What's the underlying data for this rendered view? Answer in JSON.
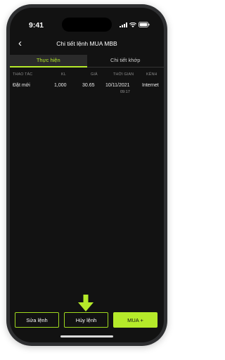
{
  "status_bar": {
    "time": "9:41"
  },
  "header": {
    "back_label": "‹",
    "title": "Chi tiết lệnh MUA MBB"
  },
  "tabs": [
    {
      "label": "Thực hiện",
      "active": true
    },
    {
      "label": "Chi tiết khớp",
      "active": false
    }
  ],
  "table": {
    "columns": [
      "THAO TÁC",
      "KL",
      "GIÁ",
      "THỜI GIAN",
      "KÊNH"
    ],
    "rows": [
      {
        "action": "Đặt mới",
        "volume": "1,000",
        "price": "30.65",
        "date": "10/11/2021",
        "time": "09:17",
        "channel": "Internet"
      }
    ]
  },
  "actions": {
    "edit_label": "Sửa lệnh",
    "cancel_label": "Hủy lệnh",
    "buy_label": "MUA +"
  },
  "colors": {
    "accent": "#b5ea2a",
    "background": "#121212",
    "frame": "#2e2f31"
  }
}
